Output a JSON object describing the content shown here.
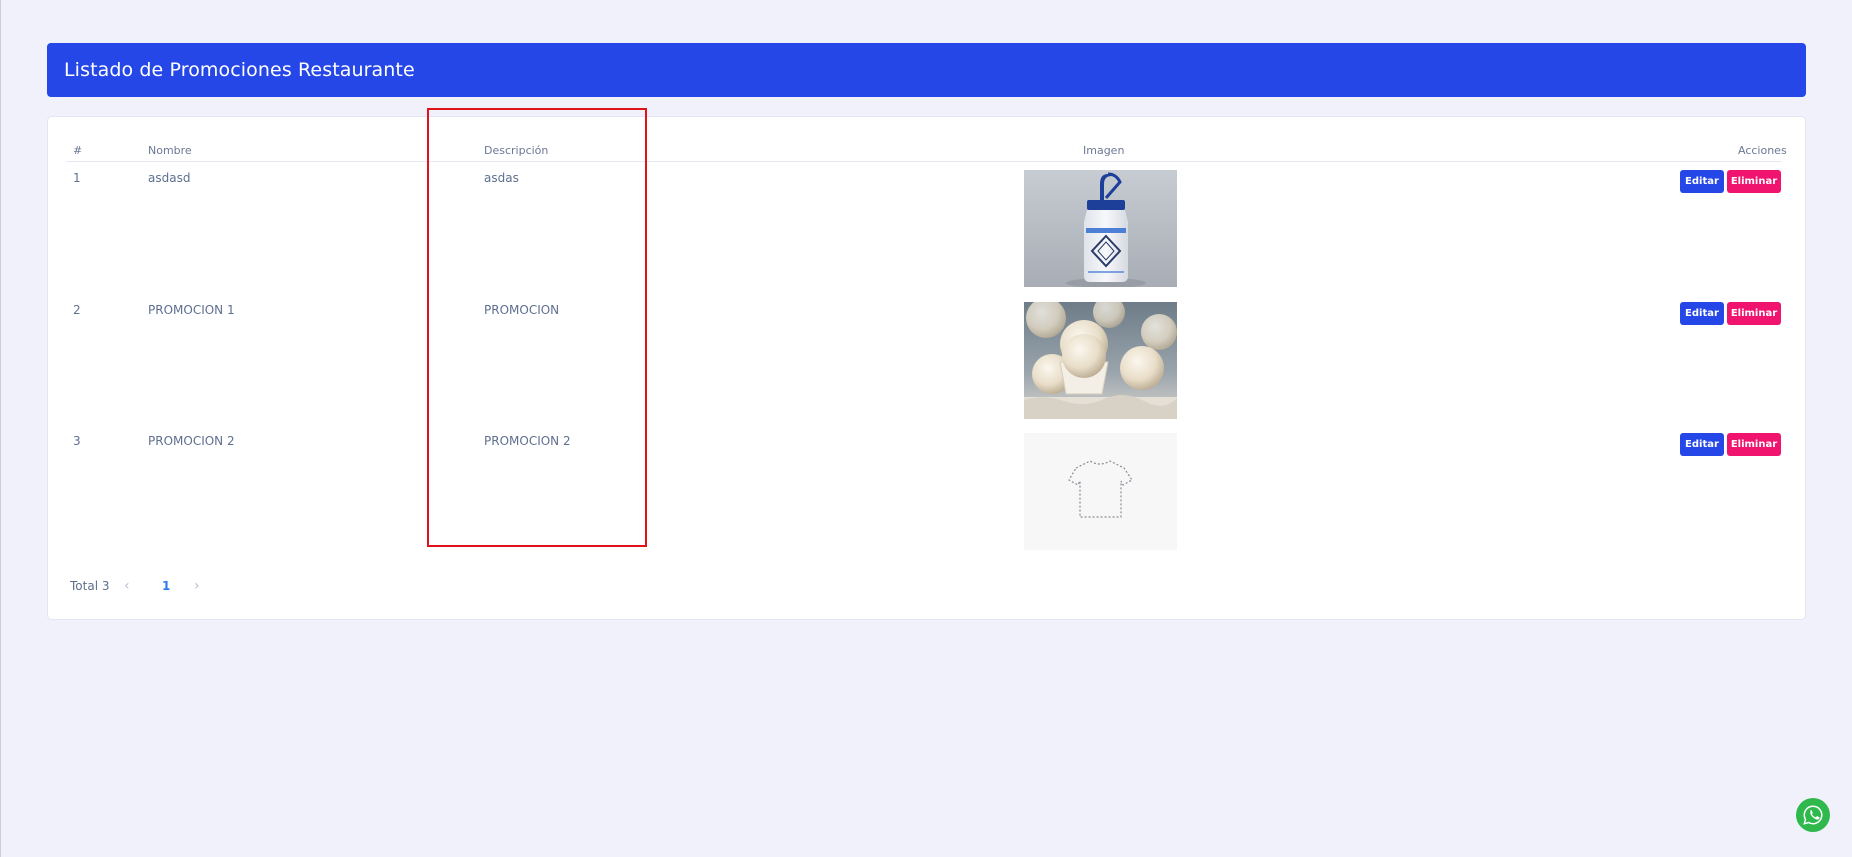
{
  "header": {
    "title": "Listado de Promociones Restaurante"
  },
  "table": {
    "columns": {
      "num": "#",
      "name": "Nombre",
      "description": "Descripción",
      "image": "Imagen",
      "actions": "Acciones"
    },
    "rows": [
      {
        "num": "1",
        "name": "asdasd",
        "description": "asdas",
        "image": "wash-bottle-photo"
      },
      {
        "num": "2",
        "name": "PROMOCION 1",
        "description": "PROMOCION",
        "image": "coconut-truffles-photo"
      },
      {
        "num": "3",
        "name": "PROMOCION 2",
        "description": "PROMOCION 2",
        "image": "tshirt-placeholder"
      }
    ],
    "edit_label": "Editar",
    "delete_label": "Eliminar"
  },
  "pagination": {
    "total": "Total 3",
    "current_page": "1",
    "prev_icon": "chevron-left-icon",
    "next_icon": "chevron-right-icon"
  },
  "colors": {
    "primary": "#2547e8",
    "danger": "#f0146e",
    "highlight": "#e0121a",
    "whatsapp": "#2fb84c"
  },
  "floating": {
    "icon": "whatsapp-icon"
  }
}
